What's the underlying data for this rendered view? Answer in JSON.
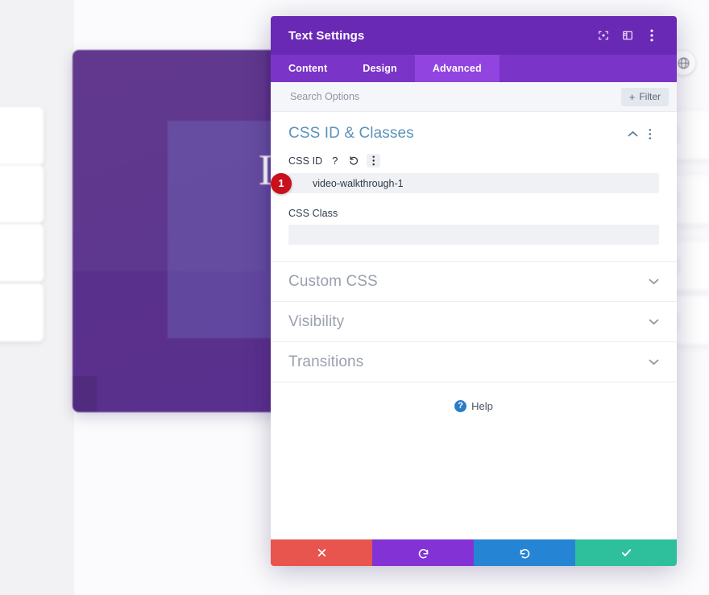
{
  "background": {
    "hero": {
      "headline": "Invest In\nYour\nFuture",
      "bg_color": "#5a3090"
    },
    "globe_badge_icon": "globe-icon",
    "left_cards_count": 4,
    "right_cards_count": 4
  },
  "modal": {
    "title": "Text Settings",
    "header_icons": [
      {
        "name": "focus-target-icon"
      },
      {
        "name": "layout-panel-icon"
      },
      {
        "name": "more-options-icon"
      }
    ],
    "tabs": [
      {
        "label": "Content",
        "active": false
      },
      {
        "label": "Design",
        "active": false
      },
      {
        "label": "Advanced",
        "active": true
      }
    ],
    "search": {
      "placeholder": "Search Options",
      "value": ""
    },
    "filter_button": {
      "label": "Filter",
      "icon": "plus-icon"
    },
    "sections": {
      "css_id_classes": {
        "title": "CSS ID & Classes",
        "expanded": true,
        "collapse_icon": "chevron-up-icon",
        "options_icon": "more-options-icon",
        "fields": [
          {
            "label": "CSS ID",
            "value": "video-walkthrough-1",
            "placeholder": "",
            "icons": [
              "help-icon",
              "reset-icon",
              "more-options-icon"
            ],
            "badge": "1"
          },
          {
            "label": "CSS Class",
            "value": "",
            "placeholder": "",
            "icons": [],
            "badge": ""
          }
        ]
      },
      "collapsed": [
        {
          "title": "Custom CSS",
          "chevron": "chevron-down-icon"
        },
        {
          "title": "Visibility",
          "chevron": "chevron-down-icon"
        },
        {
          "title": "Transitions",
          "chevron": "chevron-down-icon"
        }
      ]
    },
    "help": {
      "label": "Help",
      "icon": "help-circle-icon"
    },
    "footer_buttons": [
      {
        "name": "cancel-button",
        "icon": "close-x-icon",
        "color": "#e8544e"
      },
      {
        "name": "undo-button",
        "icon": "undo-icon",
        "color": "#8332d6"
      },
      {
        "name": "redo-button",
        "icon": "redo-icon",
        "color": "#2684d4"
      },
      {
        "name": "save-button",
        "icon": "checkmark-icon",
        "color": "#2ec09c"
      }
    ]
  },
  "colors": {
    "header_purple": "#6a29b5",
    "tabbar_purple": "#7a34c7",
    "active_tab_purple": "#9144e0",
    "section_title_blue": "#5b93b9",
    "badge_red": "#c9101c"
  }
}
